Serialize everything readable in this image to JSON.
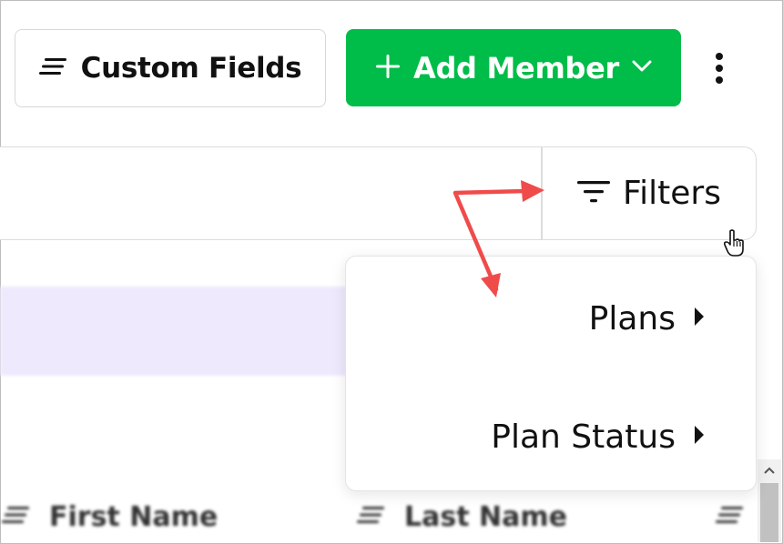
{
  "header": {
    "custom_fields_label": "Custom Fields",
    "add_member_label": "Add Member"
  },
  "toolbar": {
    "filters_label": "Filters"
  },
  "filter_menu": {
    "items": [
      {
        "label": "Plans"
      },
      {
        "label": "Plan Status"
      }
    ]
  },
  "table": {
    "columns": [
      {
        "label": "First Name"
      },
      {
        "label": "Last Name"
      }
    ]
  },
  "icons": {
    "custom_fields": "lines-icon",
    "add": "plus-icon",
    "dropdown": "chevron-down-icon",
    "more": "kebab-menu-icon",
    "filter": "filter-icon",
    "submenu": "caret-right-icon",
    "cursor": "hand-pointer-icon",
    "annotation": "red-arrow-icon"
  },
  "colors": {
    "primary_green": "#00bc48",
    "highlight_row": "#efe9fd",
    "annotation_red": "#f04b4b"
  }
}
